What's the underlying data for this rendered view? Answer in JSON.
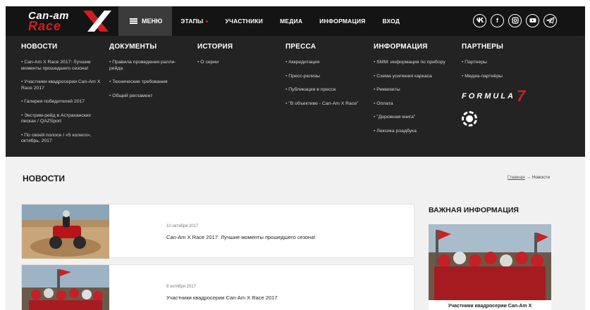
{
  "brand": {
    "line1": "Can-am",
    "line2": "Race",
    "mark": "X"
  },
  "nav": {
    "menu_label": "МЕНЮ",
    "items": [
      {
        "label": "ЭТАПЫ",
        "has_dot": true
      },
      {
        "label": "УЧАСТНИКИ"
      },
      {
        "label": "МЕДИА"
      },
      {
        "label": "ИНФОРМАЦИЯ"
      },
      {
        "label": "ВХОД"
      }
    ]
  },
  "socials": [
    "vk-icon",
    "facebook-icon",
    "instagram-icon",
    "youtube-icon",
    "telegram-icon"
  ],
  "mega": {
    "news": {
      "title": "НОВОСТИ",
      "items": [
        "Can-Am X Race 2017: Лучшие моменты прошедшего сезона!",
        "Участники квадросерии Can-Am X Race 2017",
        "Галерея победителей 2017",
        "Экстрим-рейд в Астраханских песках / QAZSport",
        "По своей полосе / «5 колесо», октябрь, 2017"
      ]
    },
    "docs": {
      "title": "ДОКУМЕНТЫ",
      "items": [
        "Правила проведения ралли-рейда",
        "Технические требования",
        "Общий регламент"
      ]
    },
    "history": {
      "title": "ИСТОРИЯ",
      "items": [
        "О серии"
      ]
    },
    "press": {
      "title": "ПРЕССА",
      "items": [
        "Аккредитация",
        "Пресс-релизы",
        "Публикации в прессе",
        "\"В объективе - Can-Am X Race\""
      ]
    },
    "info": {
      "title": "ИНФОРМАЦИЯ",
      "items": [
        "SMM: информация по прибору",
        "Схема усиления каркаса",
        "Реквизиты",
        "Оплата",
        "\"Дорожная книга\"",
        "Лексика роадбука"
      ]
    },
    "partners": {
      "title": "ПАРТНЕРЫ",
      "items": [
        "Партнеры",
        "Медиа-партнёры"
      ],
      "formula_text": "FORMULA",
      "formula_num": "7"
    }
  },
  "page": {
    "title": "НОВОСТИ",
    "breadcrumb_home": "Главная",
    "breadcrumb_sep": " → ",
    "breadcrumb_current": "Новости"
  },
  "news_cards": [
    {
      "date": "10 октября 2017",
      "text": "Can-Am X Race 2017: Лучшие моменты прошедшего сезона!"
    },
    {
      "date": "9 октября 2017",
      "text": "Участники квадросерии Can-Am X Race 2017"
    }
  ],
  "sidebar": {
    "title": "ВАЖНАЯ ИНФОРМАЦИЯ",
    "card_text": "Участники квадросерии Can-Am X"
  },
  "colors": {
    "accent": "#d01e1e",
    "header_bg": "#141414",
    "menu_bg": "#232323",
    "content_bg": "#f1f1f1"
  }
}
